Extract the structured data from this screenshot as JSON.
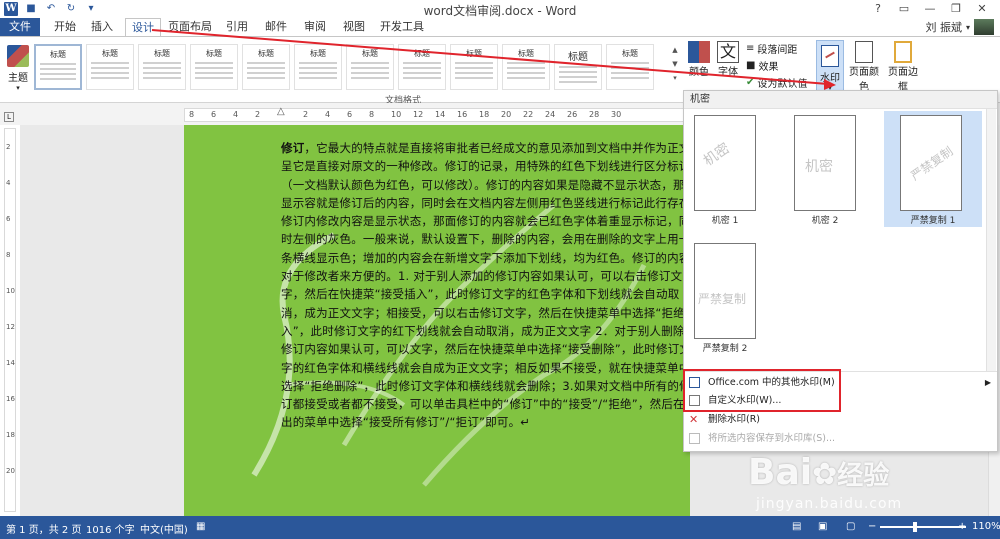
{
  "app": {
    "title": "word文档审阅.docx - Word",
    "user_name": "刘 振斌"
  },
  "window_controls": [
    "?",
    "▭",
    "—",
    "❐",
    "✕"
  ],
  "tabs": [
    "文件",
    "开始",
    "插入",
    "设计",
    "页面布局",
    "引用",
    "邮件",
    "审阅",
    "视图",
    "开发工具"
  ],
  "ribbon": {
    "themes_label": "主题",
    "styles": [
      "标题",
      "标题",
      "标题",
      "标题",
      "标题",
      "标题",
      "标题",
      "标题",
      "标题",
      "标题",
      "标题",
      "标题",
      "标题"
    ],
    "group_label": "文档格式",
    "colors_label": "颜色",
    "fonts_label": "字体",
    "paragraph_spacing": "段落间距",
    "effects": "效果",
    "set_default": "设为默认值",
    "watermark": "水印",
    "page_color": "页面颜色",
    "page_border": "页面边框"
  },
  "ruler": {
    "ticks": [
      "8",
      "6",
      "4",
      "2",
      "2",
      "4",
      "6",
      "8",
      "10",
      "12",
      "14",
      "16",
      "18",
      "20",
      "22",
      "24",
      "26",
      "28",
      "30"
    ],
    "vticks": [
      "2",
      "4",
      "6",
      "8",
      "10",
      "12",
      "14",
      "16",
      "18",
      "20"
    ]
  },
  "document": {
    "lead": "修订",
    "text": "，它最大的特点就是直接将审批者已经成文的意见添加到文档中并作为正文呈它是直接对原文的一种修改。修订的记录，用特殊的红色下划线进行区分标记（一文档默认颜色为红色，可以修改）。修订的内容如果是隐藏不显示状态，那面显示容就是修订后的内容，同时会在文档内容左侧用红色竖线进行标记此行存在修订内修改内容是显示状态，那面修订的内容就会已红色字体着重显示标记，同时左侧的灰色。一般来说，默认设置下，删除的内容，会用在删除的文字上用一条横线显示色；增加的内容会在新增文字下添加下划线，均为红色。修订的内容对于修改者来方便的。1. 对于别人添加的修订内容如果认可，可以右击修订文字，然后在快捷菜“接受插入”，此时修订文字的红色字体和下划线就会自动取消，成为正文文字；相接受，可以右击修订文字，然后在快捷菜单中选择“拒绝插入”，此时修订文字的红下划线就会自动取消，成为正文文字 2．对于别人删除的修订内容如果认可，可以文字，然后在快捷菜单中选择“接受删除”，此时修订文字的红色字体和横线线就会自成为正文文字；相反如果不接受，就在快捷菜单中选择“拒绝删除”，此时修订文字体和横线线就会删除；3.如果对文档中所有的修订都接受或者都不接受，可以单击具栏中的“修订”中的“接受”/“拒绝”，然后在弹出的菜单中选择“接受所有修订”/“拒订”即可。↵"
  },
  "watermark_dropdown": {
    "header": "机密",
    "tiles": [
      {
        "text": "机密",
        "caption": "机密 1"
      },
      {
        "text": "机密",
        "caption": "机密 2"
      },
      {
        "text": "严禁复制",
        "caption": "严禁复制 1"
      },
      {
        "text": "严禁复制",
        "caption": "严禁复制 2"
      }
    ],
    "menu": [
      {
        "label": "Office.com 中的其他水印(M)",
        "disabled": false
      },
      {
        "label": "自定义水印(W)...",
        "disabled": false
      },
      {
        "label": "删除水印(R)",
        "disabled": false
      },
      {
        "label": "将所选内容保存到水印库(S)...",
        "disabled": true
      }
    ]
  },
  "status": {
    "page": "第 1 页，共 2 页",
    "words": "1016 个字",
    "language": "中文(中国)",
    "zoom": "110%"
  },
  "baidu": {
    "brand": "Bai",
    "jingyan": "经验",
    "url": "jingyan.baidu.com"
  },
  "colors": {
    "accent": "#2b579a",
    "page_background": "#81c341",
    "highlight": "#e0242c"
  }
}
